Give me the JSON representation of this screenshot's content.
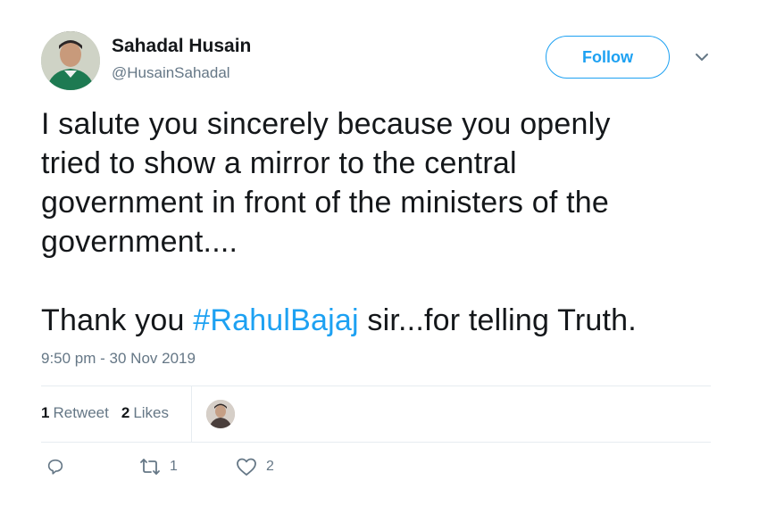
{
  "author": {
    "name": "Sahadal Husain",
    "handle": "@HusainSahadal"
  },
  "follow_label": "Follow",
  "tweet": {
    "line1": "I salute you sincerely because you openly",
    "line2": "tried to show a mirror to the central",
    "line3": "government in front of the ministers of the",
    "line4": "government....",
    "para2_before": "Thank you ",
    "hashtag": "#RahulBajaj",
    "para2_after": " sir...for telling Truth."
  },
  "timestamp": "9:50 pm - 30 Nov 2019",
  "stats": {
    "retweets_count": "1",
    "retweets_label": "Retweet",
    "likes_count": "2",
    "likes_label": "Likes"
  },
  "actions": {
    "reply_icon": "reply-icon",
    "retweet_icon": "retweet-icon",
    "retweet_count": "1",
    "like_icon": "heart-icon",
    "like_count": "2"
  },
  "colors": {
    "accent": "#1da1f2",
    "text": "#14171a",
    "muted": "#657786",
    "divider": "#e6ecf0"
  }
}
